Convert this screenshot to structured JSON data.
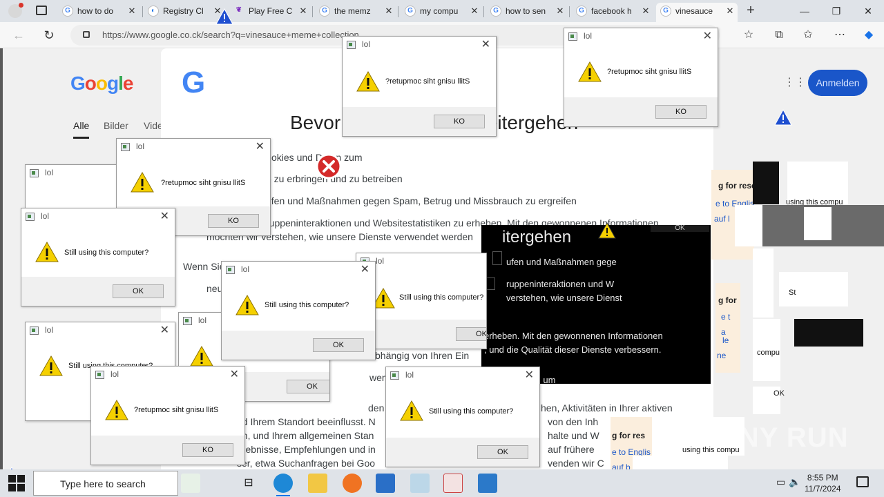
{
  "browser": {
    "tabs": [
      {
        "label": "how to do"
      },
      {
        "label": "Registry Cl"
      },
      {
        "label": "Play Free C"
      },
      {
        "label": "the memz"
      },
      {
        "label": "my compu"
      },
      {
        "label": "how to sen"
      },
      {
        "label": "facebook h"
      },
      {
        "label": "vinesauce",
        "active": true
      }
    ],
    "url": "https://www.google.co.ck/search?q=vinesauce+meme+collection",
    "new_tab": "+",
    "minimize": "—",
    "maximize": "❐",
    "close": "✕"
  },
  "google": {
    "logo_letters": [
      "G",
      "o",
      "o",
      "g",
      "l",
      "e"
    ],
    "tabs": [
      "Alle",
      "Bilder",
      "Vide"
    ],
    "sign_in": "Anmelden",
    "consent": {
      "title": "Bevor Sie zu Google weitergehen",
      "lines": [
        "okies und Daten zum",
        "e zu erbringen und zu betreiben",
        "ufen und Maßnahmen gegen Spam, Betrug und Missbrauch zu ergreifen",
        "ruppeninteraktionen und Websitestatistiken zu erheben. Mit den gewonnenen Informationen",
        "möchten wir verstehen, wie unsere Dienste verwendet werden",
        "Wenn Sie",
        "neu",
        "bhängig von Ihren Ein",
        "wen",
        "den u. a. von",
        "nd Ihrem Standort beeinflusst. N",
        "en, und Ihrem allgemeinen Stan",
        "rgebnisse, Empfehlungen und in",
        "ser, etwa Suchanfragen bei Goo",
        "hen, Aktivitäten in Ihrer aktiven",
        "von den Inh",
        "halte und W",
        "auf frühere",
        "venden wir C"
      ]
    }
  },
  "dialogs": {
    "title": "lol",
    "msg_normal": "Still using this computer?",
    "msg_reversed": "?retupmoc siht gnisu llitS",
    "ok": "OK",
    "ok_reversed": "KO"
  },
  "dark_panel": {
    "lines": [
      "itergehen",
      "ufen und Maßnahmen gege",
      "ruppeninteraktionen und W",
      "verstehen, wie unsere Dienst",
      "erheben. Mit den gewonnenen Informationen",
      ", und die Qualität dieser Dienste verbessern.",
      "auch, um"
    ],
    "ok": "OK"
  },
  "side_fragments": {
    "texts": [
      "g for rese",
      "e to Englis",
      "auf l",
      "using this compu",
      "g for",
      "e t",
      "a",
      "le",
      "ne",
      "compu",
      "OK",
      "St",
      "g for res",
      "using this compu",
      "e to Englis",
      "auf b"
    ]
  },
  "watermark": "ANY RUN",
  "taskbar": {
    "search_placeholder": "Type here to search",
    "time": "8:55 PM",
    "date": "11/7/2024"
  },
  "colors": {
    "accent": "#1a56c9",
    "warning": "#f5d000"
  }
}
